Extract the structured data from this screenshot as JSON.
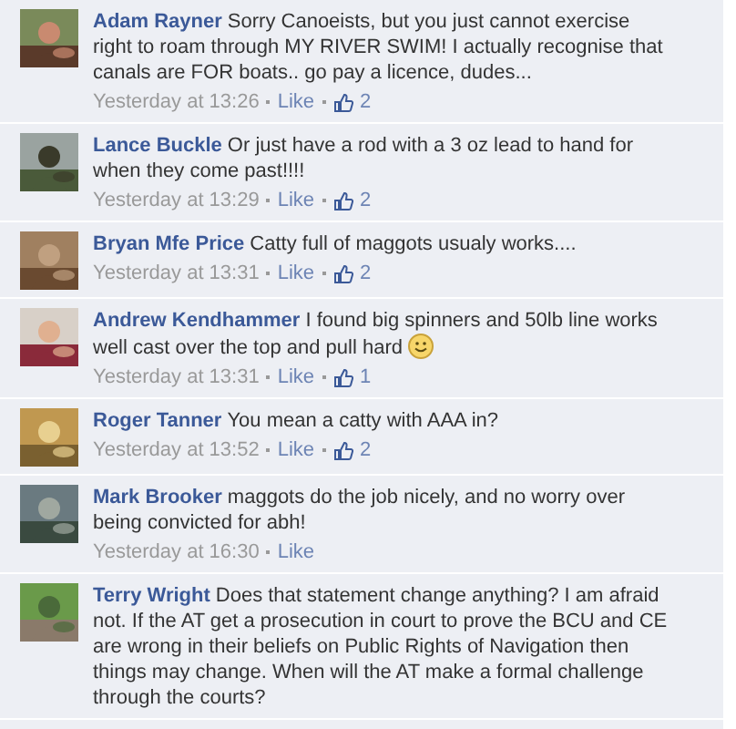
{
  "comments": [
    {
      "author": "Adam Rayner",
      "text": "Sorry Canoeists, but you just cannot exercise right to roam through MY RIVER SWIM! I actually recognise that canals are FOR boats.. go pay a licence, dudes...",
      "time": "Yesterday at 13:26",
      "action": "Like",
      "likes": "2"
    },
    {
      "author": "Lance Buckle",
      "text": "Or just have a rod with a 3 oz lead to hand for when they come past!!!!",
      "time": "Yesterday at 13:29",
      "action": "Like",
      "likes": "2"
    },
    {
      "author": "Bryan Mfe Price",
      "text": "Catty full of maggots usualy works....",
      "time": "Yesterday at 13:31",
      "action": "Like",
      "likes": "2"
    },
    {
      "author": "Andrew Kendhammer",
      "text": "I found big spinners and 50lb line works well cast over the top and pull hard",
      "smiley": true,
      "time": "Yesterday at 13:31",
      "action": "Like",
      "likes": "1"
    },
    {
      "author": "Roger Tanner",
      "text": "You mean a catty with AAA in?",
      "time": "Yesterday at 13:52",
      "action": "Like",
      "likes": "2"
    },
    {
      "author": "Mark Brooker",
      "text": "maggots do the job nicely, and no worry over being convicted for abh!",
      "time": "Yesterday at 16:30",
      "action": "Like"
    },
    {
      "author": "Terry Wright",
      "text": "Does that statement change anything? I am afraid not. If the AT get a prosecution in court to prove the BCU and CE are wrong in their beliefs on Public Rights of Navigation then things may change. When will the AT make a formal challenge through the courts?"
    }
  ]
}
